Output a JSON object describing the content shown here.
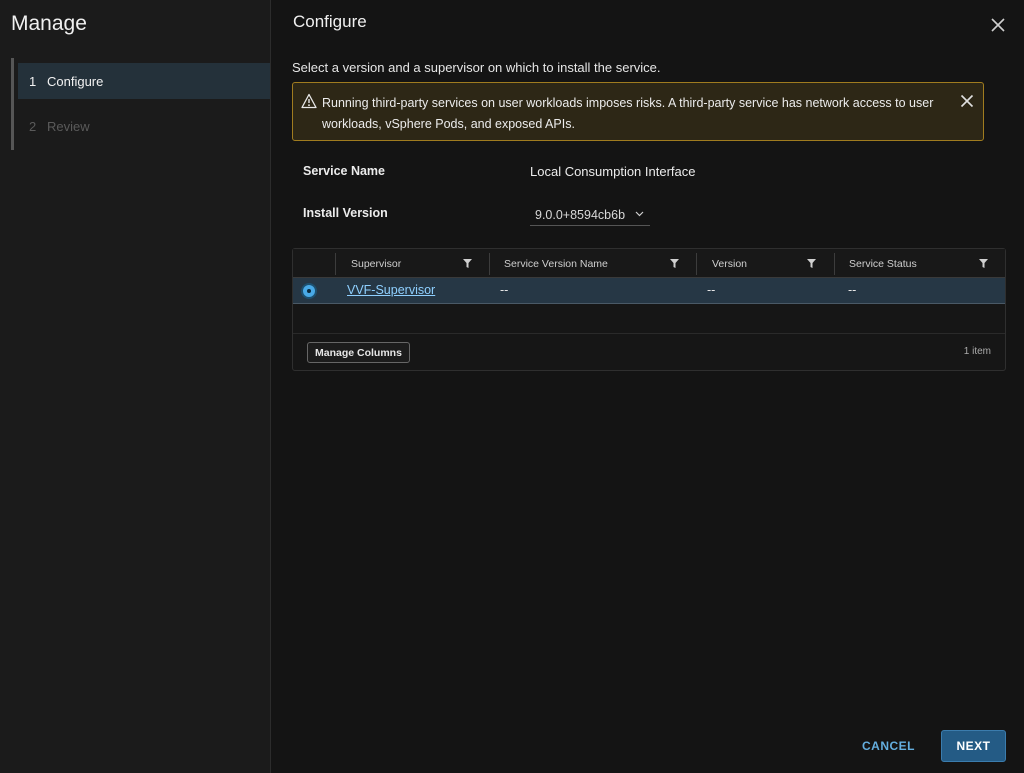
{
  "sidebar": {
    "title": "Manage",
    "steps": [
      {
        "number": "1",
        "label": "Configure",
        "state": "active"
      },
      {
        "number": "2",
        "label": "Review",
        "state": "disabled"
      }
    ]
  },
  "dialog": {
    "title": "Configure",
    "intro": "Select a version and a supervisor on which to install the service.",
    "alert": {
      "type": "warning",
      "text": "Running third-party services on user workloads imposes risks. A third-party service has network access to user workloads, vSphere Pods, and exposed APIs."
    },
    "fields": {
      "service_name_label": "Service Name",
      "service_name_value": "Local Consumption Interface",
      "install_version_label": "Install Version",
      "install_version_value": "9.0.0+8594cb6b"
    },
    "grid": {
      "columns": [
        "Supervisor",
        "Service Version Name",
        "Version",
        "Service Status"
      ],
      "rows": [
        {
          "selected": true,
          "supervisor": "VVF-Supervisor",
          "service_version_name": "--",
          "version": "--",
          "service_status": "--"
        }
      ],
      "manage_columns_label": "Manage Columns",
      "item_count": "1 item"
    },
    "footer": {
      "cancel_label": "CANCEL",
      "next_label": "NEXT"
    }
  },
  "colors": {
    "accent": "#49a9e6",
    "primary_button": "#245b85",
    "warning_border": "#a07c1f",
    "selected_row": "#263745"
  }
}
